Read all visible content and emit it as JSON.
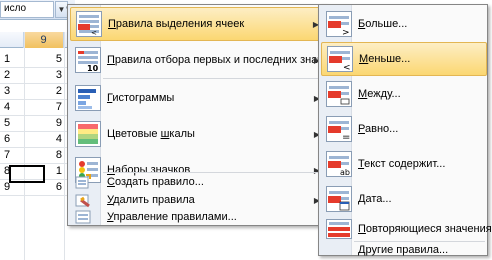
{
  "ribbon": {
    "number_format_value": "исло",
    "expander_glyph": "⌐"
  },
  "sheet": {
    "columns": [
      "",
      "9",
      ""
    ],
    "rows": [
      {
        "a": "1",
        "b": "5"
      },
      {
        "a": "2",
        "b": "3"
      },
      {
        "a": "3",
        "b": "2"
      },
      {
        "a": "4",
        "b": "7"
      },
      {
        "a": "5",
        "b": "9"
      },
      {
        "a": "6",
        "b": "4"
      },
      {
        "a": "7",
        "b": "8"
      },
      {
        "a": "8",
        "b": "1"
      },
      {
        "a": "9",
        "b": "6"
      }
    ]
  },
  "menu": {
    "highlight_rules": {
      "prefix": "",
      "hotkey": "П",
      "rest": "равила выделения ячеек"
    },
    "top_bottom_rules": {
      "hotkey": "П",
      "rest": "равила отбора первых и последних значений"
    },
    "data_bars": {
      "hotkey": "Г",
      "rest": "истограммы"
    },
    "color_scales": {
      "prefix": "Цветовые ",
      "hotkey": "ш",
      "rest": "калы"
    },
    "icon_sets": {
      "hotkey": "Н",
      "rest": "аборы значков"
    },
    "new_rule": {
      "hotkey": "С",
      "rest": "оздать правило..."
    },
    "clear_rules": {
      "hotkey": "У",
      "rest": "далить правила"
    },
    "manage_rules": {
      "hotkey": "У",
      "rest": "правление правилами..."
    }
  },
  "submenu": {
    "greater": {
      "hotkey": "Б",
      "rest": "ольше..."
    },
    "less": {
      "hotkey": "М",
      "rest": "еньше..."
    },
    "between": {
      "hotkey": "М",
      "rest": "ежду..."
    },
    "equal": {
      "hotkey": "Р",
      "rest": "авно..."
    },
    "text_contains": {
      "hotkey": "Т",
      "rest": "екст содержит..."
    },
    "date": {
      "hotkey": "Д",
      "rest": "ата..."
    },
    "duplicates": {
      "hotkey": "П",
      "rest": "овторяющиеся значения..."
    },
    "more_rules": {
      "hotkey": "Д",
      "rest": "ругие правила..."
    }
  },
  "colors": {
    "highlight": "#fbd772",
    "accent_red": "#e53b2c",
    "accent_blue": "#2a5fb5"
  }
}
